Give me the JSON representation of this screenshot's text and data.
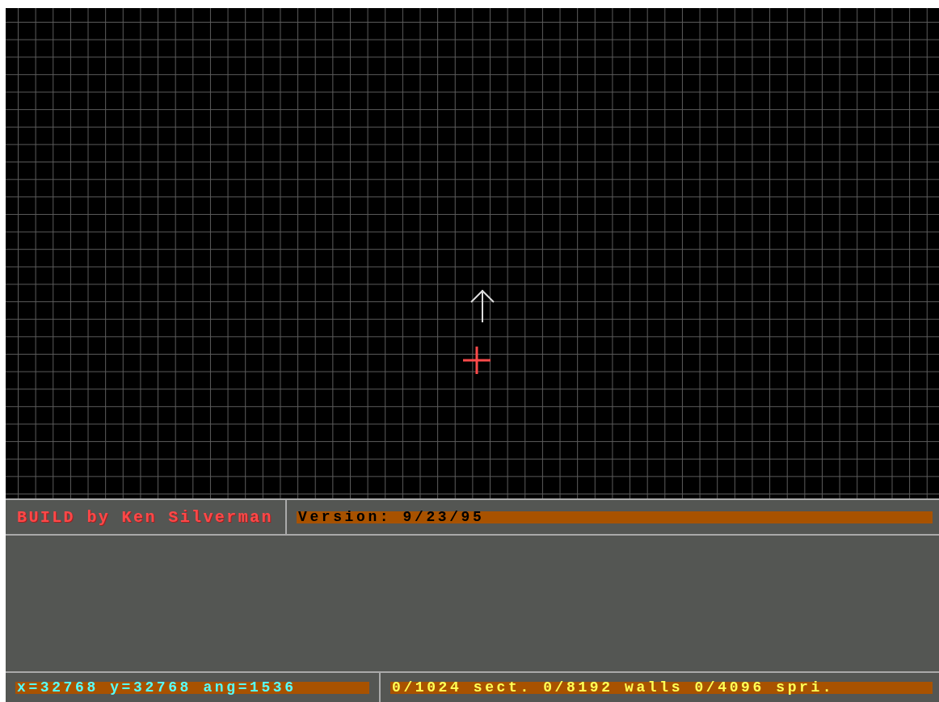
{
  "header": {
    "title": "BUILD by Ken Silverman",
    "version": "Version: 9/23/95"
  },
  "status_bar": {
    "position": "x=32768 y=32768 ang=1536",
    "counts": "0/1024 sect. 0/8192 walls 0/4096 spri."
  }
}
